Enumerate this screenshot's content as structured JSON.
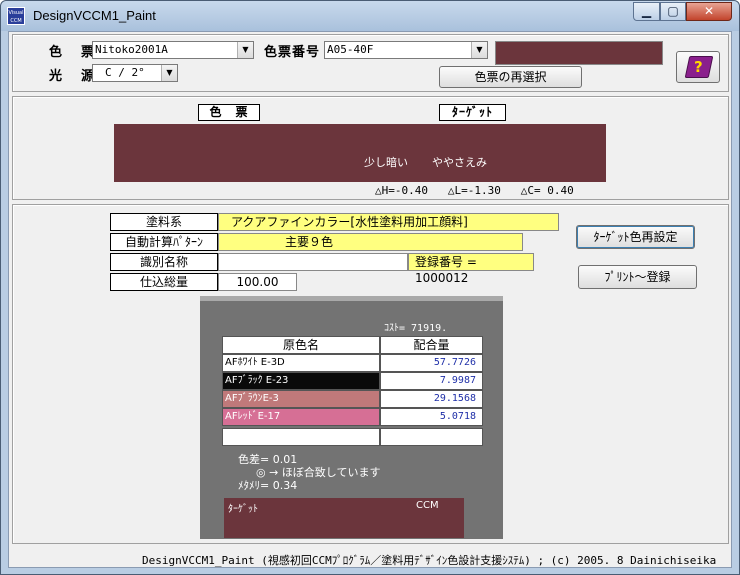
{
  "window": {
    "title": "DesignVCCM1_Paint",
    "icon_text": "Visual CCM"
  },
  "header": {
    "color_chart_label": "色　票",
    "color_chart_value": "Nitoko2001A",
    "color_number_label": "色票番号",
    "color_number_value": "A05-40F",
    "light_source_label": "光　源",
    "light_source_value": "C / 2°",
    "reselect_button": "色票の再選択"
  },
  "compare": {
    "chart_label": "色　票",
    "target_label": "ﾀｰｹﾞｯﾄ",
    "text_dark": "少し暗い",
    "text_vivid": "ややさえみ",
    "delta_h": "△H=-0.40",
    "delta_l": "△L=-1.30",
    "delta_c": "△C= 0.40"
  },
  "form": {
    "paint_type_label": "塗料系",
    "paint_type_value": "アクアファインカラー[水性塗料用加工顔料]",
    "auto_pattern_label": "自動計算ﾊﾟﾀｰﾝ",
    "auto_pattern_value": "主要９色",
    "id_name_label": "識別名称",
    "id_name_value": "",
    "reg_number": "登録番号 = 1000012",
    "total_label": "仕込総量",
    "total_value": "100.00",
    "target_reset_button": "ﾀｰｹﾞｯﾄ色再設定",
    "print_register_button": "ﾌﾟﾘﾝﾄ～登録"
  },
  "formula": {
    "cost": "ｺｽﾄ= 71919.",
    "col_name": "原色名",
    "col_amount": "配合量",
    "rows": [
      {
        "name": "AFﾎﾜｲﾄ E-3D",
        "amount": "57.7726",
        "bg": "#ffffff",
        "fg": "#000000"
      },
      {
        "name": "AFﾌﾞﾗｯｸ E-23",
        "amount": "7.9987",
        "bg": "#0a0a0a",
        "fg": "#ffffff"
      },
      {
        "name": "AFﾌﾞﾗｳﾝE-3",
        "amount": "29.1568",
        "bg": "#c0797a",
        "fg": "#ffffff"
      },
      {
        "name": "AFﾚｯﾄﾞE-17",
        "amount": "5.0718",
        "bg": "#d66f95",
        "fg": "#ffffff"
      },
      {
        "name": "",
        "amount": "",
        "bg": "#ffffff",
        "fg": "#000000"
      }
    ],
    "color_diff": "色差= 0.01",
    "match_text": "◎ → ほぼ合致しています",
    "metamerism": "ﾒﾀﾒﾘ= 0.34",
    "result_target": "ﾀｰｹﾞｯﾄ",
    "result_ccm": "CCM"
  },
  "status_bar": {
    "text": "DesignVCCM1_Paint (視感初回CCMﾌﾟﾛｸﾞﾗﾑ／塗料用ﾃﾞｻﾞｲﾝ色設計支援ｼｽﾃﾑ) ; (c) 2005. 8 Dainichiseika"
  },
  "colors": {
    "target_swatch": "#6b353c",
    "highlight_yellow": "#ffff80",
    "panel_dark": "#737373",
    "amount_blue": "#1f2fa8"
  }
}
